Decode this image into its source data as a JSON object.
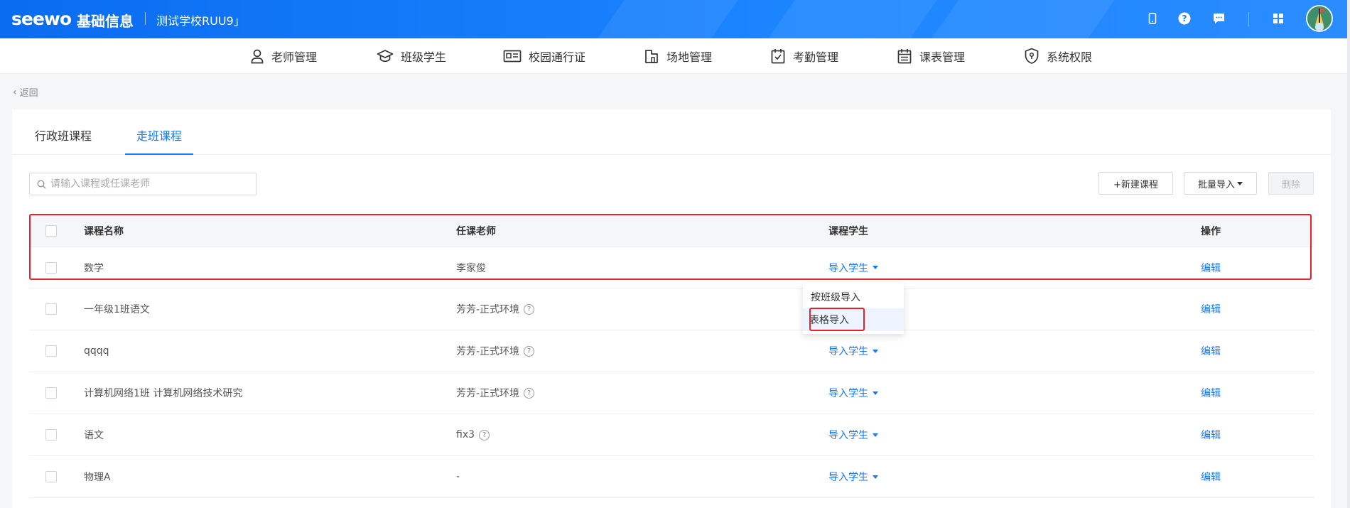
{
  "header": {
    "logo": "seewo",
    "title": "基础信息",
    "school": "测试学校RUU9」",
    "icons": [
      "phone-icon",
      "help-icon",
      "message-icon",
      "apps-icon"
    ],
    "avatar": "avatar"
  },
  "nav": {
    "items": [
      {
        "label": "老师管理",
        "icon": "teacher-icon"
      },
      {
        "label": "班级学生",
        "icon": "graduation-cap-icon"
      },
      {
        "label": "校园通行证",
        "icon": "id-card-icon"
      },
      {
        "label": "场地管理",
        "icon": "building-icon"
      },
      {
        "label": "考勤管理",
        "icon": "calendar-check-icon"
      },
      {
        "label": "课表管理",
        "icon": "schedule-icon"
      },
      {
        "label": "系统权限",
        "icon": "shield-icon"
      }
    ]
  },
  "back_label": "返回",
  "tabs": [
    {
      "label": "行政班课程",
      "active": false
    },
    {
      "label": "走班课程",
      "active": true
    }
  ],
  "search": {
    "placeholder": "请输入课程或任课老师",
    "value": ""
  },
  "toolbar": {
    "new_label": "+新建课程",
    "batch_import_label": "批量导入",
    "delete_label": "删除"
  },
  "table": {
    "columns": [
      "课程名称",
      "任课老师",
      "课程学生",
      "操作"
    ],
    "rows": [
      {
        "name": "数学",
        "teacher": "李家俊",
        "teacher_help": false,
        "students": "导入学生",
        "action": "编辑"
      },
      {
        "name": "一年级1班语文",
        "teacher": "芳芳-正式环境",
        "teacher_help": true,
        "students": "",
        "action": "编辑"
      },
      {
        "name": "qqqq",
        "teacher": "芳芳-正式环境",
        "teacher_help": true,
        "students": "导入学生",
        "action": "编辑"
      },
      {
        "name": "计算机网络1班 计算机网络技术研究",
        "teacher": "芳芳-正式环境",
        "teacher_help": true,
        "students": "导入学生",
        "action": "编辑"
      },
      {
        "name": "语文",
        "teacher": "fix3",
        "teacher_help": true,
        "students": "导入学生",
        "action": "编辑"
      },
      {
        "name": "物理A",
        "teacher": "-",
        "teacher_help": false,
        "students": "导入学生",
        "action": "编辑"
      }
    ]
  },
  "dropdown": {
    "items": [
      "按班级导入",
      "表格导入"
    ],
    "hovered": "表格导入"
  },
  "colors": {
    "primary": "#1677ff",
    "header_bg": "#0a6cf0",
    "highlight": "#e8222a"
  }
}
